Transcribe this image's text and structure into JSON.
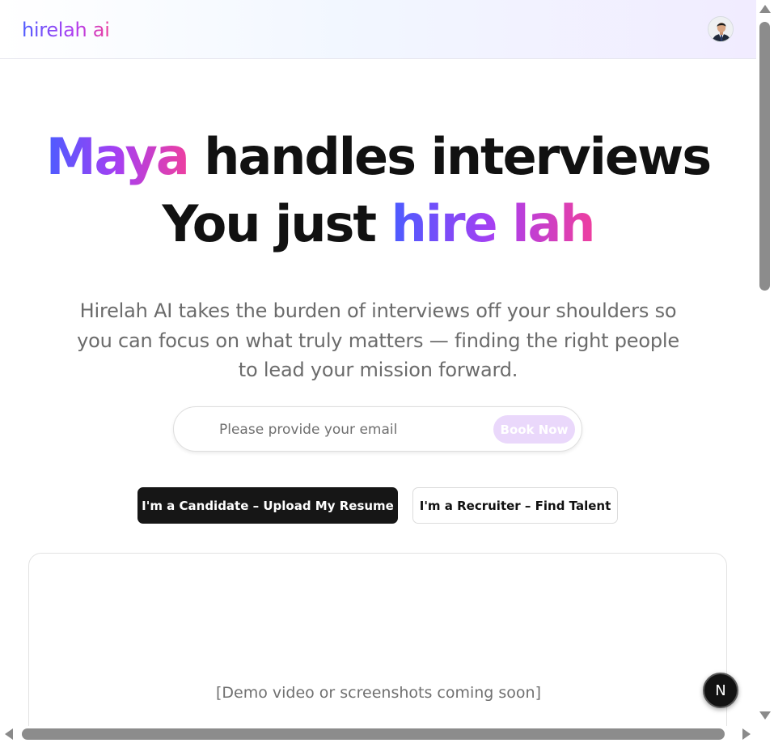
{
  "header": {
    "logo_text": "hirelah ai",
    "avatar_alt": "user avatar"
  },
  "hero": {
    "line1_highlight": "Maya",
    "line1_rest": " handles interviews",
    "line2_start": "You just ",
    "line2_highlight": "hire lah",
    "subtitle": "Hirelah AI takes the burden of interviews off your shoulders so you can focus on what truly matters — finding the right people to lead your mission forward."
  },
  "email_form": {
    "placeholder": "Please provide your email",
    "value": "",
    "button_label": "Book Now"
  },
  "cta": {
    "candidate_label": "I'm a Candidate – Upload My Resume",
    "recruiter_label": "I'm a Recruiter – Find Talent"
  },
  "demo": {
    "placeholder_text": "[Demo video or screenshots coming soon]"
  },
  "floating_badge": {
    "letter": "N"
  },
  "colors": {
    "gradient_start": "#4b5cff",
    "gradient_mid": "#a63ff2",
    "gradient_end": "#ee3f9f",
    "primary_button": "#161616",
    "book_button_bg": "#ead8fb"
  },
  "icons": {
    "avatar": "user-avatar-icon",
    "badge": "next-dev-badge-icon"
  }
}
